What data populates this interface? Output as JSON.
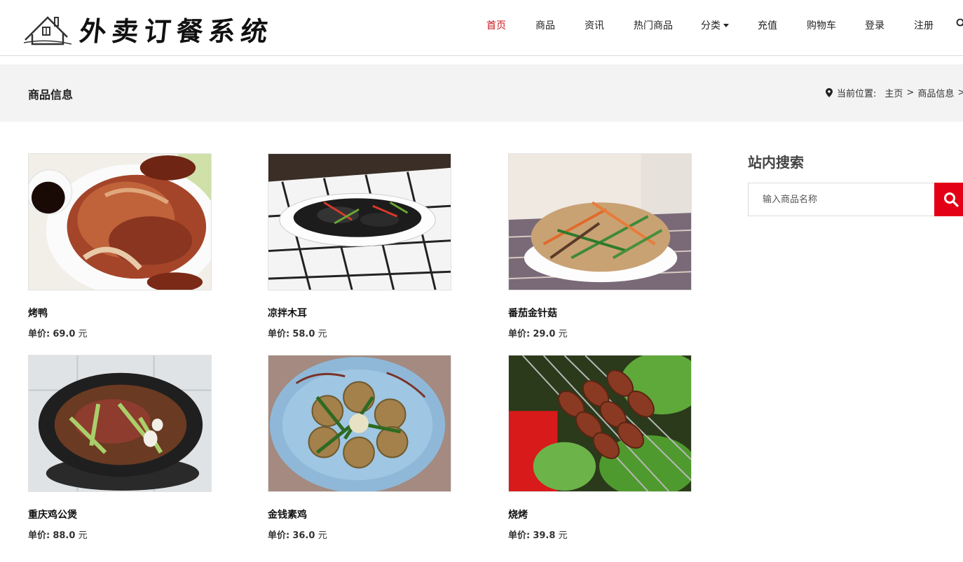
{
  "brand": {
    "logo_text": "外卖订餐系统"
  },
  "nav": {
    "items": [
      {
        "label": "首页",
        "active": true
      },
      {
        "label": "商品"
      },
      {
        "label": "资讯"
      },
      {
        "label": "热门商品"
      },
      {
        "label": "分类",
        "dropdown": true
      },
      {
        "label": "充值"
      },
      {
        "label": "购物车"
      },
      {
        "label": "登录"
      },
      {
        "label": "注册"
      }
    ],
    "active_color": "#c8161d",
    "search_icon": "search-icon"
  },
  "titlebar": {
    "title": "商品信息",
    "location_label": "当前位置:",
    "crumbs": [
      "主页",
      "商品信息"
    ]
  },
  "products": [
    {
      "name": "烤鸭",
      "price_label": "单价:",
      "price": "69.0",
      "unit": "元"
    },
    {
      "name": "凉拌木耳",
      "price_label": "单价:",
      "price": "58.0",
      "unit": "元"
    },
    {
      "name": "番茄金针菇",
      "price_label": "单价:",
      "price": "29.0",
      "unit": "元"
    },
    {
      "name": "重庆鸡公煲",
      "price_label": "单价:",
      "price": "88.0",
      "unit": "元"
    },
    {
      "name": "金钱素鸡",
      "price_label": "单价:",
      "price": "36.0",
      "unit": "元"
    },
    {
      "name": "烧烤",
      "price_label": "单价:",
      "price": "39.8",
      "unit": "元"
    }
  ],
  "sidebar": {
    "title": "站内搜索",
    "search_placeholder": "输入商品名称",
    "accent": "#e30016"
  }
}
